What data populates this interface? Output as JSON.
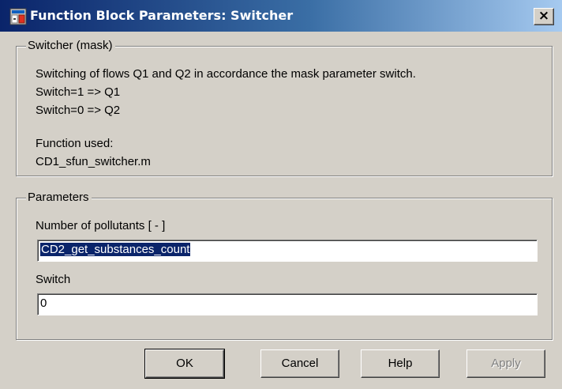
{
  "window": {
    "title": "Function Block Parameters: Switcher",
    "close_glyph": "×"
  },
  "mask_group": {
    "legend": "Switcher (mask)",
    "description_lines": [
      "Switching of flows Q1 and Q2 in accordance the mask parameter switch.",
      "Switch=1 => Q1",
      "Switch=0 => Q2"
    ],
    "function_label": "Function used:",
    "function_name": "CD1_sfun_switcher.m"
  },
  "parameters_group": {
    "legend": "Parameters",
    "pollutants_label": "Number of pollutants [ - ]",
    "pollutants_value": "CD2_get_substances_count",
    "switch_label": "Switch",
    "switch_value": "0"
  },
  "buttons": {
    "ok": "OK",
    "cancel": "Cancel",
    "help": "Help",
    "apply": "Apply"
  },
  "colors": {
    "titlebar_start": "#0a246a",
    "titlebar_end": "#a6caf0",
    "dialog_bg": "#d4d0c8",
    "selection": "#0a246a"
  },
  "icons": {
    "title_icon": "simulink-block-icon",
    "close_icon": "close-icon"
  }
}
